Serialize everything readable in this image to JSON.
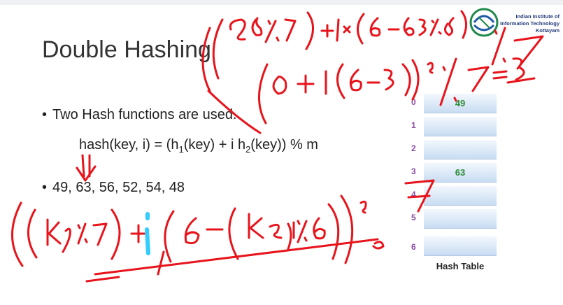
{
  "slide": {
    "title": "Double Hashing",
    "bullets": [
      "Two Hash functions are used.",
      "49, 63, 56, 52, 54, 48"
    ],
    "formula": {
      "lead": "hash(key, i) = (h",
      "sub1": "1",
      "mid": "(key) + i h",
      "sub2": "2",
      "tail": "(key)) % m"
    }
  },
  "logo": {
    "lines": [
      "Indian Institute of",
      "Information Technology",
      "Kottayam"
    ]
  },
  "hash_table": {
    "caption": "Hash Table",
    "rows": [
      {
        "index": "0",
        "value": "49"
      },
      {
        "index": "1",
        "value": ""
      },
      {
        "index": "2",
        "value": ""
      },
      {
        "index": "3",
        "value": "63"
      },
      {
        "index": "4",
        "value": ""
      },
      {
        "index": "5",
        "value": ""
      },
      {
        "index": "6",
        "value": ""
      }
    ]
  },
  "colors": {
    "ink": "#e8141c",
    "highlight": "#33ccff",
    "index": "#8a4ea6",
    "cell_value": "#2d8a3a"
  }
}
